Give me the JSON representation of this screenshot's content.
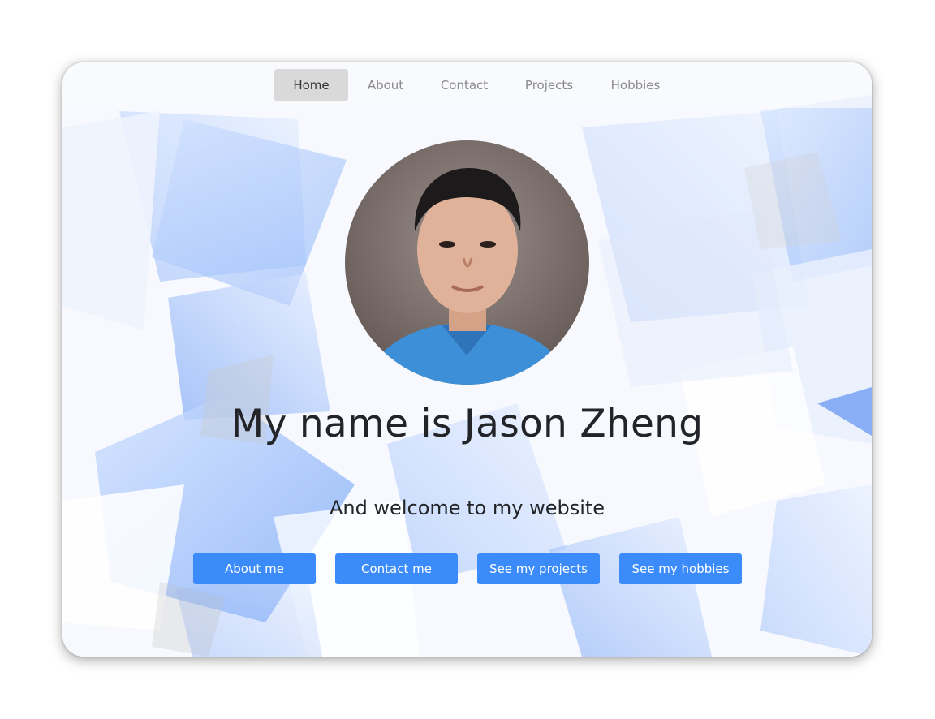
{
  "nav": {
    "items": [
      {
        "label": "Home",
        "active": true
      },
      {
        "label": "About",
        "active": false
      },
      {
        "label": "Contact",
        "active": false
      },
      {
        "label": "Projects",
        "active": false
      },
      {
        "label": "Hobbies",
        "active": false
      }
    ]
  },
  "hero": {
    "avatar_icon": "profile-photo",
    "headline": "My name is Jason Zheng",
    "subheadline": "And welcome to my website"
  },
  "buttons": {
    "about": "About me",
    "contact": "Contact me",
    "projects": "See my projects",
    "hobbies": "See my hobbies"
  },
  "colors": {
    "accent": "#3b8bfb",
    "nav_active_bg": "#d9d9d9",
    "text_dark": "#222428",
    "nav_text": "#8a8a8a"
  }
}
